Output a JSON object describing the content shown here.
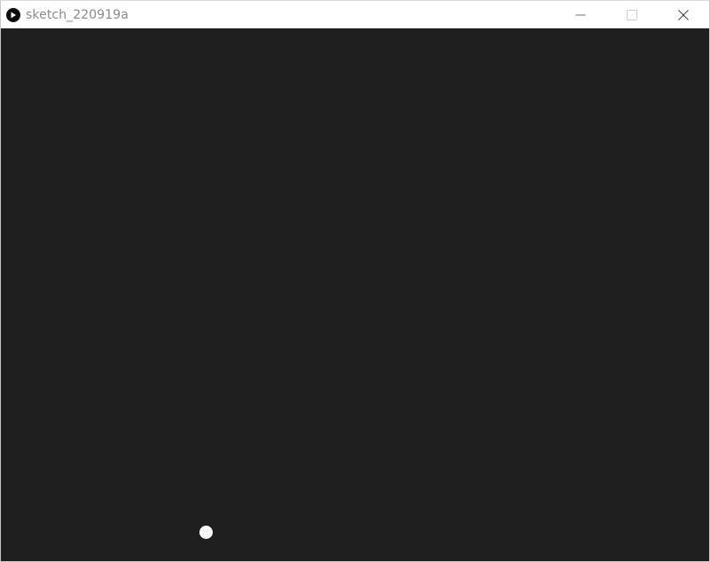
{
  "window": {
    "title": "sketch_220919a",
    "app_icon": "play-icon",
    "controls": {
      "minimize_icon": "minimize-icon",
      "maximize_icon": "maximize-icon",
      "close_icon": "close-icon"
    }
  },
  "canvas": {
    "background_color": "#1f1f1f",
    "ball_color": "#ffffff"
  }
}
